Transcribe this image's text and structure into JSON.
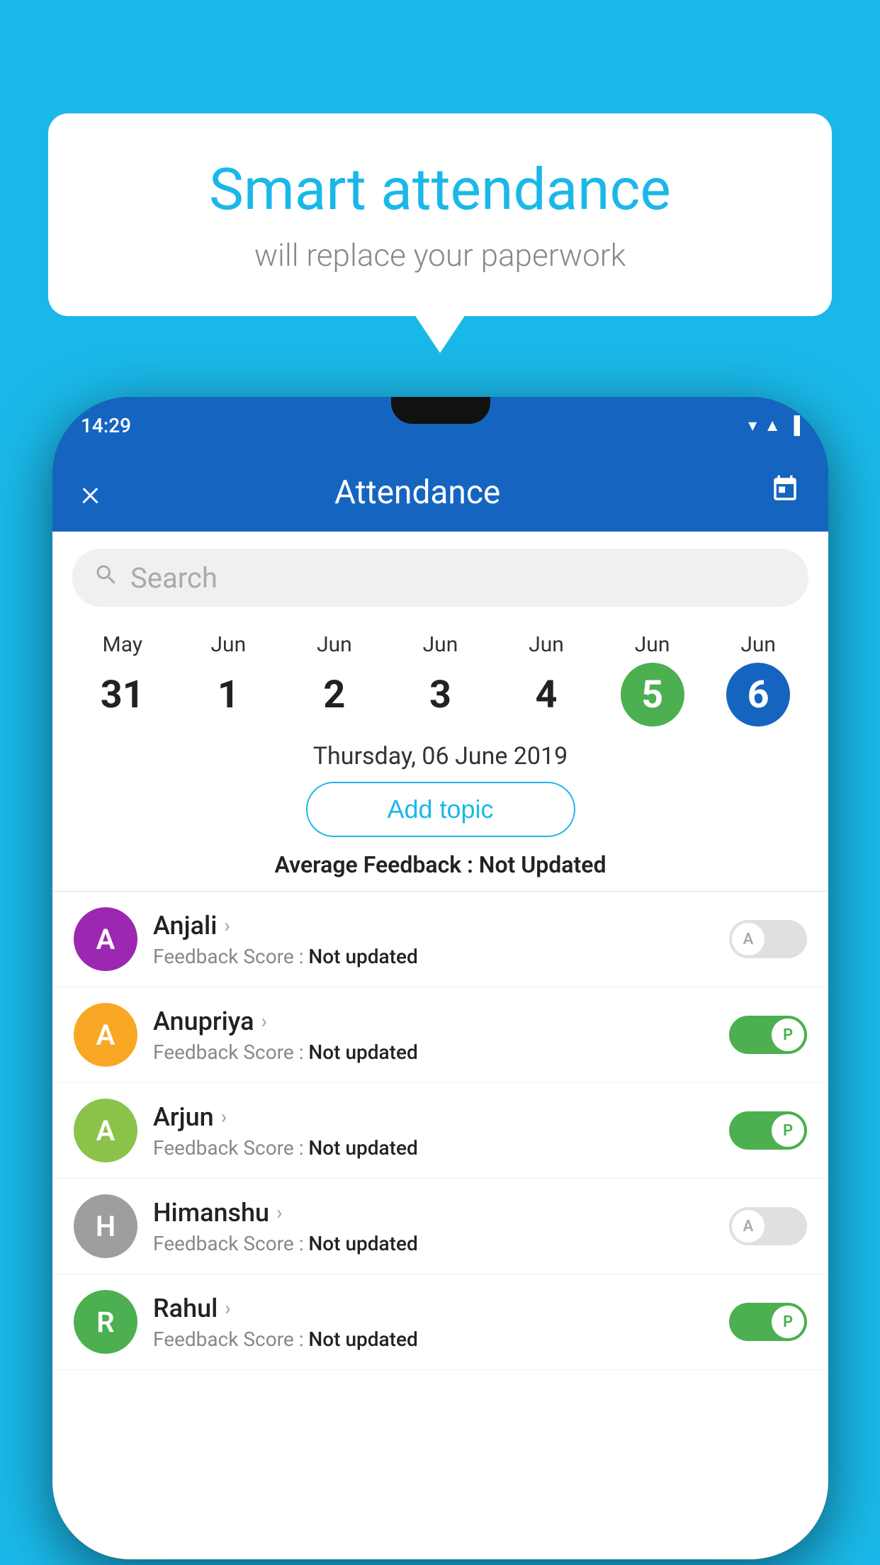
{
  "background": {
    "color": "#1ab8e8"
  },
  "bubble": {
    "title": "Smart attendance",
    "subtitle": "will replace your paperwork"
  },
  "phone": {
    "status_time": "14:29",
    "appbar": {
      "title": "Attendance",
      "close_label": "×",
      "calendar_icon": "📅"
    },
    "search": {
      "placeholder": "Search"
    },
    "dates": [
      {
        "month": "May",
        "day": "31",
        "state": "normal"
      },
      {
        "month": "Jun",
        "day": "1",
        "state": "normal"
      },
      {
        "month": "Jun",
        "day": "2",
        "state": "normal"
      },
      {
        "month": "Jun",
        "day": "3",
        "state": "normal"
      },
      {
        "month": "Jun",
        "day": "4",
        "state": "normal"
      },
      {
        "month": "Jun",
        "day": "5",
        "state": "today"
      },
      {
        "month": "Jun",
        "day": "6",
        "state": "selected"
      }
    ],
    "selected_date": "Thursday, 06 June 2019",
    "add_topic_label": "Add topic",
    "avg_feedback_label": "Average Feedback :",
    "avg_feedback_value": "Not Updated",
    "students": [
      {
        "name": "Anjali",
        "initial": "A",
        "avatar_color": "#9c27b0",
        "feedback_label": "Feedback Score :",
        "feedback_value": "Not updated",
        "toggle_state": "off",
        "toggle_label": "A"
      },
      {
        "name": "Anupriya",
        "initial": "A",
        "avatar_color": "#f9a825",
        "feedback_label": "Feedback Score :",
        "feedback_value": "Not updated",
        "toggle_state": "on",
        "toggle_label": "P"
      },
      {
        "name": "Arjun",
        "initial": "A",
        "avatar_color": "#8bc34a",
        "feedback_label": "Feedback Score :",
        "feedback_value": "Not updated",
        "toggle_state": "on",
        "toggle_label": "P"
      },
      {
        "name": "Himanshu",
        "initial": "H",
        "avatar_color": "#9e9e9e",
        "feedback_label": "Feedback Score :",
        "feedback_value": "Not updated",
        "toggle_state": "off",
        "toggle_label": "A"
      },
      {
        "name": "Rahul",
        "initial": "R",
        "avatar_color": "#4caf50",
        "feedback_label": "Feedback Score :",
        "feedback_value": "Not updated",
        "toggle_state": "on",
        "toggle_label": "P"
      }
    ]
  }
}
